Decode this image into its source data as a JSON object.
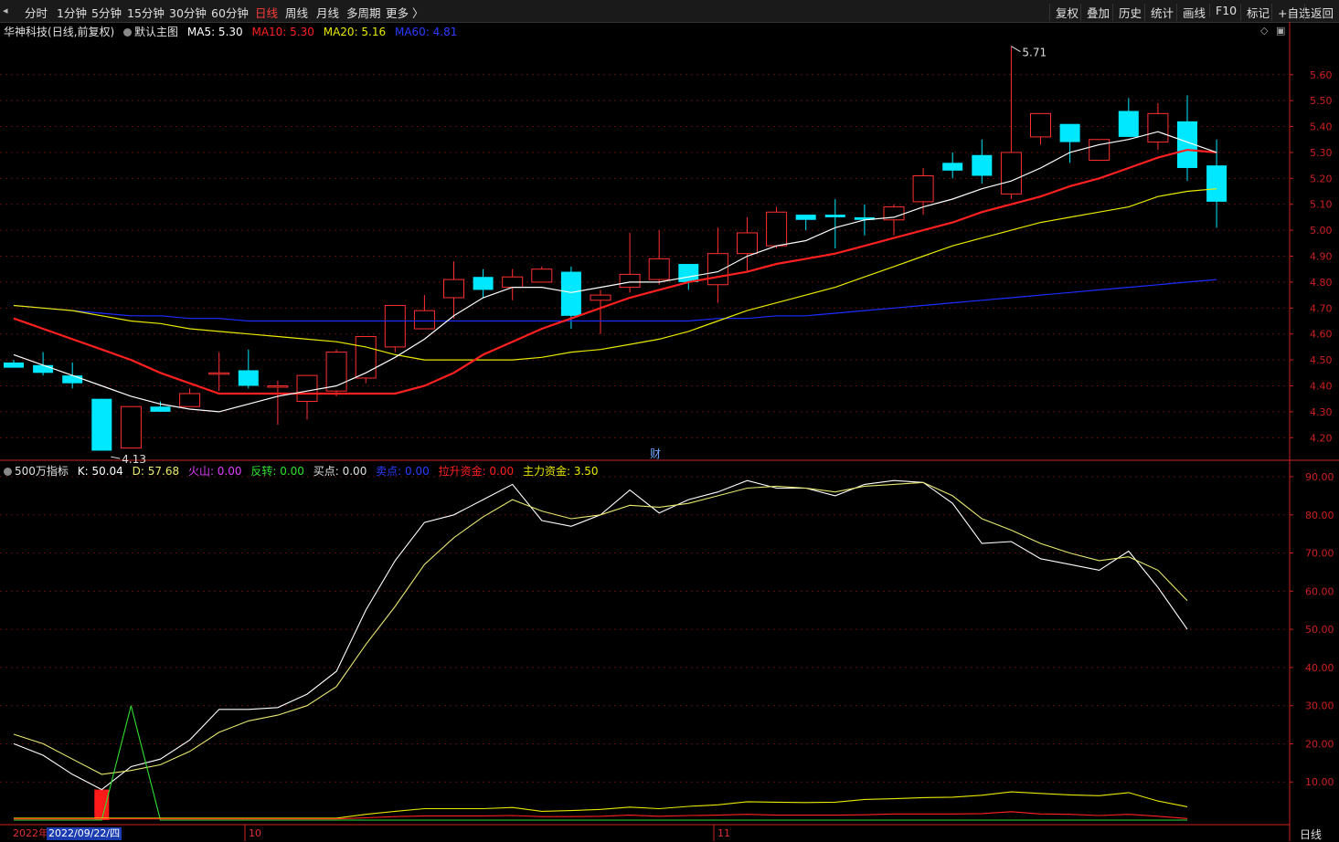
{
  "toolbar": {
    "periods": [
      "分时",
      "1分钟",
      "5分钟",
      "15分钟",
      "30分钟",
      "60分钟",
      "日线",
      "周线",
      "月线",
      "多周期",
      "更多 〉"
    ],
    "active_period": "日线",
    "tools": [
      "复权",
      "叠加",
      "历史",
      "统计",
      "画线",
      "F10",
      "标记",
      "+自选",
      "返回"
    ]
  },
  "main_legend": {
    "stock": "华神科技",
    "mode": "(日线,前复权)",
    "template": "默认主图",
    "ma5": "MA5: 5.30",
    "ma10": "MA10: 5.30",
    "ma20": "MA20: 5.16",
    "ma60": "MA60: 4.81"
  },
  "sub_legend": {
    "name": "500万指标",
    "k": "K: 50.04",
    "d": "D: 57.68",
    "huoshan": "火山: 0.00",
    "fanzhuan": "反转: 0.00",
    "maidian": "买点: 0.00",
    "maidian2": "卖点: 0.00",
    "lasheng": "拉升资金: 0.00",
    "zhuli": "主力资金: 3.50"
  },
  "annotations": {
    "high_label": "5.71",
    "low_label": "4.13",
    "cai": "财"
  },
  "x_axis": {
    "date_prefix": "2022年",
    "date_current": "2022/09/22/四",
    "month_oct": "10",
    "month_nov": "11"
  },
  "period_label": "日线",
  "colors": {
    "up": "#ff3030",
    "down": "#00e8ff",
    "ma5": "#ffffff",
    "ma10": "#ff2020",
    "ma20": "#e8e800",
    "ma60": "#1c2cff",
    "k": "#ffffff",
    "d": "#e8e870",
    "axis": "#cc2020"
  },
  "chart_data": [
    {
      "type": "candlestick",
      "title": "",
      "ylim": [
        4.12,
        5.74
      ],
      "y_ticks": [
        "5.60",
        "5.50",
        "5.40",
        "5.30",
        "5.20",
        "5.10",
        "5.00",
        "4.90",
        "4.80",
        "4.70",
        "4.60",
        "4.50",
        "4.40",
        "4.30",
        "4.20"
      ],
      "ohlc": [
        [
          4.49,
          4.5,
          4.47,
          4.47
        ],
        [
          4.48,
          4.53,
          4.44,
          4.45
        ],
        [
          4.44,
          4.49,
          4.39,
          4.41
        ],
        [
          4.35,
          4.35,
          4.15,
          4.15
        ],
        [
          4.16,
          4.32,
          4.16,
          4.32
        ],
        [
          4.32,
          4.34,
          4.31,
          4.3
        ],
        [
          4.32,
          4.39,
          4.33,
          4.37
        ],
        [
          4.45,
          4.53,
          4.38,
          4.45
        ],
        [
          4.46,
          4.54,
          4.39,
          4.4
        ],
        [
          4.4,
          4.42,
          4.25,
          4.4
        ],
        [
          4.34,
          4.44,
          4.27,
          4.44
        ],
        [
          4.38,
          4.54,
          4.36,
          4.53
        ],
        [
          4.43,
          4.53,
          4.41,
          4.59
        ],
        [
          4.55,
          4.69,
          4.53,
          4.71
        ],
        [
          4.62,
          4.75,
          4.62,
          4.69
        ],
        [
          4.74,
          4.88,
          4.66,
          4.81
        ],
        [
          4.82,
          4.85,
          4.74,
          4.77
        ],
        [
          4.78,
          4.85,
          4.73,
          4.82
        ],
        [
          4.8,
          4.86,
          4.8,
          4.85
        ],
        [
          4.84,
          4.86,
          4.62,
          4.67
        ],
        [
          4.73,
          4.77,
          4.6,
          4.75
        ],
        [
          4.78,
          4.99,
          4.76,
          4.83
        ],
        [
          4.81,
          5.0,
          4.79,
          4.89
        ],
        [
          4.87,
          4.87,
          4.77,
          4.8
        ],
        [
          4.79,
          5.01,
          4.72,
          4.91
        ],
        [
          4.91,
          5.05,
          4.84,
          4.99
        ],
        [
          4.94,
          5.09,
          4.93,
          5.07
        ],
        [
          5.06,
          5.06,
          5.0,
          5.04
        ],
        [
          5.06,
          5.12,
          4.93,
          5.05
        ],
        [
          5.05,
          5.1,
          4.98,
          5.04
        ],
        [
          5.04,
          5.1,
          4.98,
          5.09
        ],
        [
          5.11,
          5.24,
          5.06,
          5.21
        ],
        [
          5.26,
          5.3,
          5.2,
          5.23
        ],
        [
          5.29,
          5.35,
          5.18,
          5.21
        ],
        [
          5.14,
          5.71,
          5.12,
          5.3
        ],
        [
          5.36,
          5.44,
          5.33,
          5.45
        ],
        [
          5.41,
          5.39,
          5.26,
          5.34
        ],
        [
          5.27,
          5.35,
          5.29,
          5.35
        ],
        [
          5.46,
          5.51,
          5.37,
          5.36
        ],
        [
          5.34,
          5.49,
          5.31,
          5.45
        ],
        [
          5.42,
          5.52,
          5.19,
          5.24
        ],
        [
          5.25,
          5.35,
          5.01,
          5.11
        ]
      ],
      "ma5": [
        4.52,
        4.48,
        4.44,
        4.4,
        4.36,
        4.33,
        4.31,
        4.3,
        4.33,
        4.36,
        4.38,
        4.4,
        4.45,
        4.51,
        4.58,
        4.67,
        4.74,
        4.78,
        4.78,
        4.76,
        4.78,
        4.8,
        4.8,
        4.82,
        4.84,
        4.9,
        4.94,
        4.96,
        5.01,
        5.04,
        5.05,
        5.09,
        5.12,
        5.16,
        5.19,
        5.24,
        5.3,
        5.33,
        5.35,
        5.38,
        5.34,
        5.3
      ],
      "ma10": [
        4.66,
        4.62,
        4.58,
        4.54,
        4.5,
        4.45,
        4.41,
        4.37,
        4.37,
        4.37,
        4.37,
        4.37,
        4.37,
        4.37,
        4.4,
        4.45,
        4.52,
        4.57,
        4.62,
        4.66,
        4.7,
        4.74,
        4.77,
        4.8,
        4.82,
        4.84,
        4.87,
        4.89,
        4.91,
        4.94,
        4.97,
        5.0,
        5.03,
        5.07,
        5.1,
        5.13,
        5.17,
        5.2,
        5.24,
        5.28,
        5.31,
        5.3
      ],
      "ma20": [
        4.71,
        4.7,
        4.69,
        4.67,
        4.65,
        4.64,
        4.62,
        4.61,
        4.6,
        4.59,
        4.58,
        4.57,
        4.55,
        4.52,
        4.5,
        4.5,
        4.5,
        4.5,
        4.51,
        4.53,
        4.54,
        4.56,
        4.58,
        4.61,
        4.65,
        4.69,
        4.72,
        4.75,
        4.78,
        4.82,
        4.86,
        4.9,
        4.94,
        4.97,
        5.0,
        5.03,
        5.05,
        5.07,
        5.09,
        5.13,
        5.15,
        5.16
      ],
      "ma60": [
        4.71,
        4.7,
        4.69,
        4.68,
        4.67,
        4.67,
        4.66,
        4.66,
        4.65,
        4.65,
        4.65,
        4.65,
        4.65,
        4.65,
        4.65,
        4.65,
        4.65,
        4.65,
        4.65,
        4.65,
        4.65,
        4.65,
        4.65,
        4.65,
        4.66,
        4.66,
        4.67,
        4.67,
        4.68,
        4.69,
        4.7,
        4.71,
        4.72,
        4.73,
        4.74,
        4.75,
        4.76,
        4.77,
        4.78,
        4.79,
        4.8,
        4.81
      ]
    },
    {
      "type": "line",
      "title": "500万指标",
      "ylim": [
        0,
        92
      ],
      "y_ticks": [
        "90.00",
        "80.00",
        "70.00",
        "60.00",
        "50.00",
        "40.00",
        "30.00",
        "20.00",
        "10.00"
      ],
      "series": [
        {
          "name": "K",
          "values": [
            20.0,
            17.0,
            12.0,
            8.0,
            14.0,
            16.0,
            21.0,
            29.0,
            29.0,
            29.5,
            33.0,
            39.0,
            55.0,
            68.0,
            78.0,
            80.0,
            84.0,
            88.0,
            78.5,
            77.0,
            80.0,
            86.5,
            80.5,
            84.0,
            86.0,
            89.0,
            87.0,
            87.0,
            85.0,
            88.0,
            89.0,
            88.5,
            83.0,
            72.5,
            73.0,
            68.5,
            67.0,
            65.5,
            70.5,
            61.0,
            50.0
          ]
        },
        {
          "name": "D",
          "values": [
            22.5,
            20.0,
            16.0,
            12.0,
            13.0,
            14.5,
            18.0,
            23.0,
            26.0,
            27.5,
            30.0,
            35.0,
            46.0,
            56.0,
            67.0,
            74.0,
            79.5,
            84.0,
            81.0,
            79.0,
            80.0,
            82.5,
            82.0,
            83.0,
            85.0,
            87.0,
            87.5,
            87.0,
            86.0,
            87.5,
            88.0,
            88.5,
            85.0,
            79.0,
            76.0,
            72.5,
            70.0,
            68.0,
            69.0,
            65.5,
            57.5
          ]
        },
        {
          "name": "火山",
          "values": [
            0,
            0,
            0,
            0,
            0,
            0,
            0,
            0,
            0,
            0,
            0,
            0,
            0,
            0,
            0,
            0,
            0,
            0,
            0,
            0,
            0,
            0,
            0,
            0,
            0,
            0,
            0,
            0,
            0,
            0,
            0,
            0,
            0,
            0,
            0,
            0,
            0,
            0,
            0,
            0,
            0
          ]
        },
        {
          "name": "反转",
          "values": [
            0,
            0,
            0,
            0,
            30,
            0,
            0,
            0,
            0,
            0,
            0,
            0,
            0,
            0,
            0,
            0,
            0,
            0,
            0,
            0,
            0,
            0,
            0,
            0,
            0,
            0,
            0,
            0,
            0,
            0,
            0,
            0,
            0,
            0,
            0,
            0,
            0,
            0,
            0,
            0,
            0
          ]
        },
        {
          "name": "主力资金",
          "values": [
            0.5,
            0.5,
            0.5,
            0.5,
            0.5,
            0.5,
            0.5,
            0.5,
            0.5,
            0.5,
            0.5,
            0.5,
            1.5,
            2.3,
            3.0,
            3.0,
            3.0,
            3.3,
            2.3,
            2.5,
            2.8,
            3.4,
            3.0,
            3.6,
            4.0,
            4.8,
            4.7,
            4.6,
            4.7,
            5.4,
            5.6,
            5.9,
            6.0,
            6.5,
            7.4,
            7.0,
            6.6,
            6.4,
            7.2,
            5.0,
            3.5
          ]
        },
        {
          "name": "拉升资金",
          "values": [
            0.3,
            0.3,
            0.3,
            0.3,
            0.3,
            0.3,
            0.3,
            0.3,
            0.3,
            0.3,
            0.3,
            0.3,
            0.6,
            0.9,
            1.1,
            1.1,
            1.1,
            1.2,
            0.9,
            0.9,
            1.0,
            1.3,
            1.0,
            1.2,
            1.3,
            1.5,
            1.3,
            1.3,
            1.3,
            1.4,
            1.6,
            1.6,
            1.6,
            1.7,
            2.2,
            1.6,
            1.5,
            1.2,
            1.5,
            1.0,
            0.4
          ]
        }
      ],
      "red_bar": {
        "index": 3,
        "value": 8
      }
    }
  ]
}
